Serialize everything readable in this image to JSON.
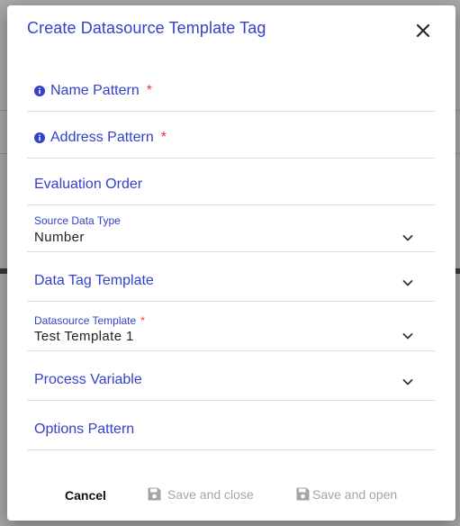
{
  "dialog": {
    "title": "Create Datasource Template Tag",
    "close_icon": "close-icon"
  },
  "fields": {
    "name_pattern": {
      "label": "Name Pattern",
      "required_mark": "*",
      "icon": "info-icon"
    },
    "address_pattern": {
      "label": "Address Pattern",
      "required_mark": "*",
      "icon": "info-icon"
    },
    "evaluation_order": {
      "label": "Evaluation Order"
    },
    "source_data_type": {
      "label": "Source Data Type",
      "value": "Number",
      "icon": "chevron-down-icon"
    },
    "data_tag_template": {
      "label": "Data Tag Template",
      "icon": "chevron-down-icon"
    },
    "datasource_template": {
      "label": "Datasource Template",
      "required_mark": "*",
      "value": "Test Template 1",
      "icon": "chevron-down-icon"
    },
    "process_variable": {
      "label": "Process Variable",
      "icon": "chevron-down-icon"
    },
    "options_pattern": {
      "label": "Options Pattern"
    }
  },
  "actions": {
    "cancel": "Cancel",
    "save_and_close": "Save and close",
    "save_and_open": "Save and open",
    "save_icon": "save-icon"
  },
  "colors": {
    "accent": "#3341c9",
    "required": "#e53935",
    "disabled": "#a5a5a5"
  }
}
